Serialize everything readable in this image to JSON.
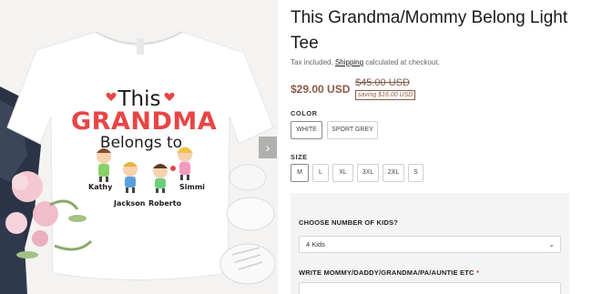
{
  "product_image": {
    "art": {
      "line1": "This",
      "line2": "GRANDMA",
      "line3": "Belongs to",
      "kids": [
        "Kathy",
        "Jackson",
        "Roberto",
        "Simmi"
      ]
    },
    "next_arrow": "›"
  },
  "product": {
    "title": "This Grandma/Mommy Belong Light Tee",
    "tax_prefix": "Tax included.",
    "shipping_link": "Shipping",
    "tax_suffix": "calculated at checkout.",
    "price": "$29.00 USD",
    "compare_price": "$45.00 USD",
    "saving": "saving $16.00 USD"
  },
  "options": {
    "color": {
      "label": "COLOR",
      "values": [
        "WHITE",
        "SPORT GREY"
      ],
      "selected": "WHITE"
    },
    "size": {
      "label": "SIZE",
      "values": [
        "M",
        "L",
        "XL",
        "3XL",
        "2XL",
        "S"
      ],
      "selected": "M"
    }
  },
  "customization": {
    "kids_label": "CHOOSE NUMBER OF KIDS?",
    "kids_value": "4 Kids",
    "write_label": "WRITE MOMMY/DADDY/GRANDMA/PA/AUNTIE ETC",
    "required_mark": "*"
  },
  "colors": {
    "price": "#8a5a46",
    "accent_red": "#e84545",
    "panel_bg": "#f4f4f5"
  }
}
